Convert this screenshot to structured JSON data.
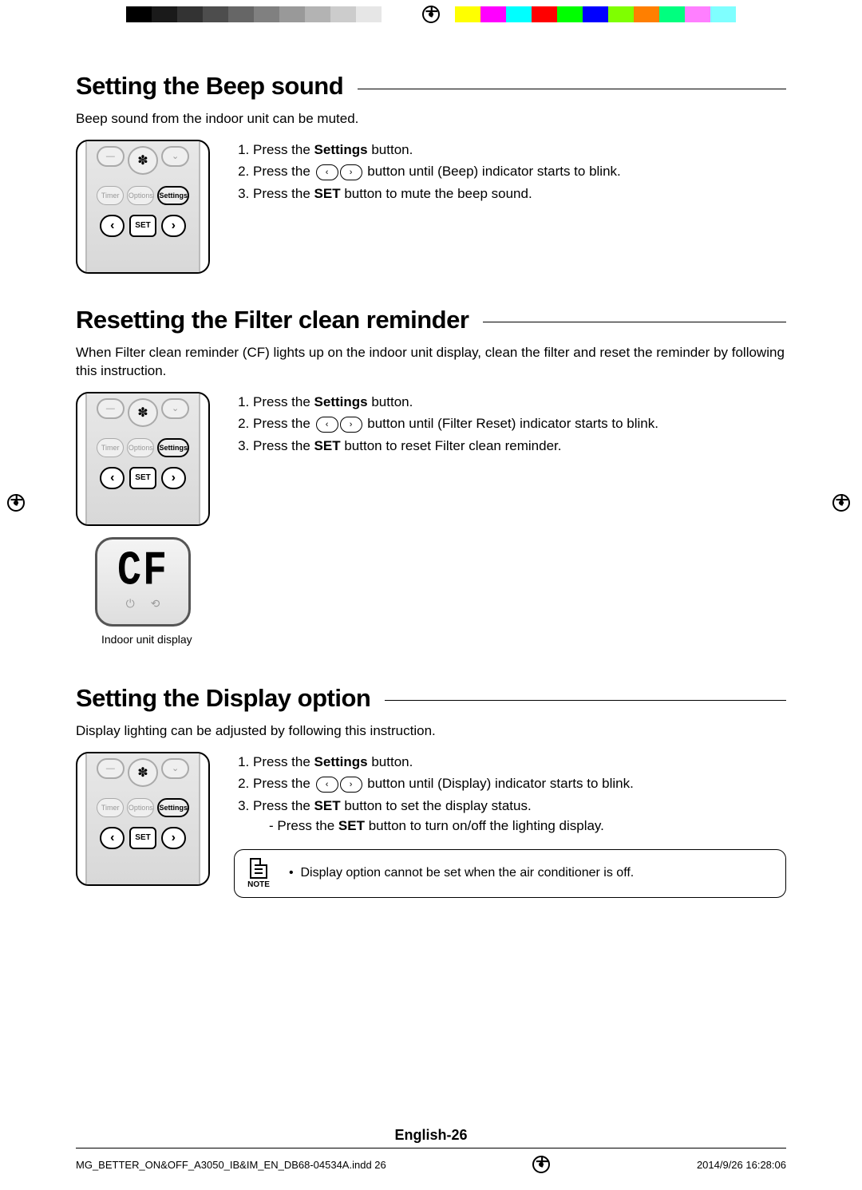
{
  "section1": {
    "title": "Setting the Beep sound",
    "intro": "Beep sound from the indoor unit can be muted.",
    "steps": {
      "s1a": "Press the ",
      "s1b": "Settings",
      "s1c": " button.",
      "s2a": "Press the ",
      "s2b": " button until (Beep) indicator starts to blink.",
      "s3a": "Press the ",
      "s3b": "SET",
      "s3c": " button to mute the beep sound."
    }
  },
  "section2": {
    "title": "Resetting the Filter clean reminder",
    "intro": "When Filter clean reminder (CF) lights up on the indoor unit display, clean the filter and reset the reminder by following this instruction.",
    "steps": {
      "s1a": "Press the ",
      "s1b": "Settings",
      "s1c": " button.",
      "s2a": "Press the ",
      "s2b": " button until (Filter Reset) indicator starts to blink.",
      "s3a": "Press the ",
      "s3b": "SET",
      "s3c": " button to reset Filter clean reminder."
    },
    "cf_label": "CF",
    "caption": "Indoor unit display"
  },
  "section3": {
    "title": "Setting the Display option",
    "intro": "Display lighting can be adjusted by following this instruction.",
    "steps": {
      "s1a": "Press the ",
      "s1b": "Settings",
      "s1c": " button.",
      "s2a": "Press the ",
      "s2b": " button until (Display) indicator starts to blink.",
      "s3a": "Press the ",
      "s3b": "SET",
      "s3c": " button to set the display status.",
      "s4a": "- Press the ",
      "s4b": "SET",
      "s4c": " button to turn on/off the lighting display."
    },
    "note_label": "NOTE",
    "note_bullet": "•",
    "note_text": "Display option cannot be set when the air conditioner is off."
  },
  "remote": {
    "timer": "Timer",
    "options": "Options",
    "settings": "Settings",
    "set": "SET",
    "left": "‹",
    "right": "›",
    "minus": "—",
    "down": "⌄"
  },
  "page_label": "English-26",
  "footer": {
    "file": "MG_BETTER_ON&OFF_A3050_IB&IM_EN_DB68-04534A.indd   26",
    "datetime": "2014/9/26   16:28:06"
  },
  "colorbar": {
    "grays": [
      "#000000",
      "#1a1a1a",
      "#333333",
      "#4d4d4d",
      "#666666",
      "#808080",
      "#999999",
      "#b3b3b3",
      "#cccccc",
      "#e6e6e6",
      "#ffffff"
    ],
    "colors": [
      "#ffff00",
      "#ff00ff",
      "#00ffff",
      "#ff0000",
      "#00ff00",
      "#0000ff",
      "#7fff00",
      "#ff7f00",
      "#00ff7f",
      "#ff7fff",
      "#7fffff"
    ]
  }
}
